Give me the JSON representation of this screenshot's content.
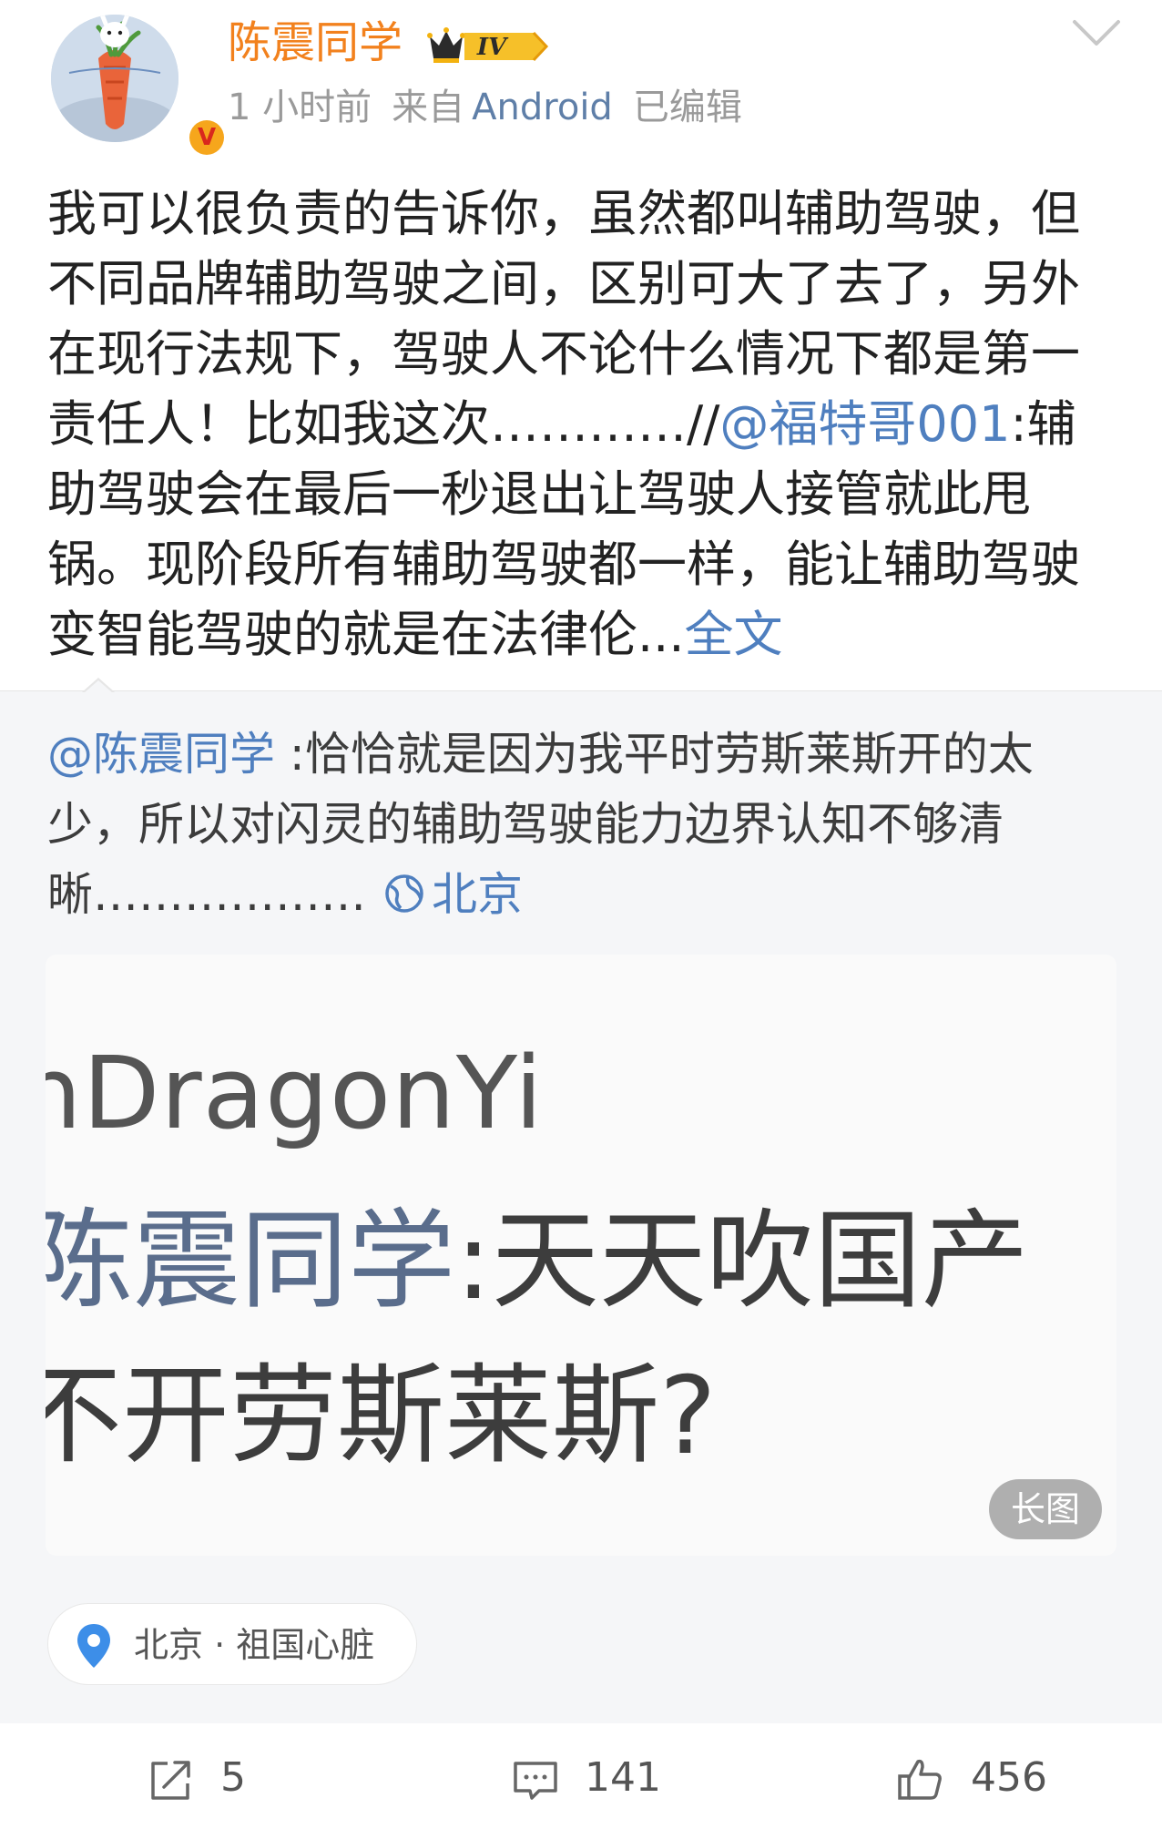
{
  "post": {
    "username": "陈震同学",
    "level_badge": "IV",
    "verified_badge": "V",
    "time": "1 小时前",
    "source_prefix": "来自",
    "source": "Android",
    "edited": "已编辑",
    "text_before_mention": "我可以很负责的告诉你，虽然都叫辅助驾驶，但不同品牌辅助驾驶之间，区别可大了去了，另外在现行法规下，驾驶人不论什么情况下都是第一责任人！比如我这次…………//",
    "mention": "@福特哥001",
    "text_after_mention": ":辅助驾驶会在最后一秒退出让驾驶人接管就此甩锅。现阶段所有辅助驾驶都一样，能让辅助驾驶变智能驾驶的就是在法律伦...",
    "full_text_link": "全文"
  },
  "repost": {
    "mention": "@陈震同学",
    "text": " :恰恰就是因为我平时劳斯莱斯开的太少，所以对闪灵的辅助驾驶能力边界认知不够清晰………………",
    "location": "北京",
    "image": {
      "line1": "nDragonYi",
      "line2_name": "陈震同学",
      "line2_rest": ":天天吹国产",
      "line3": "不开劳斯莱斯?",
      "long_image_tag": "长图"
    }
  },
  "location_pill": {
    "text": "北京 · 祖国心脏"
  },
  "actions": {
    "repost_count": "5",
    "comment_count": "141",
    "like_count": "456"
  },
  "colors": {
    "username": "#f2811d",
    "link": "#4f7fbf",
    "meta": "#9a9a9a",
    "repost_bg": "#f5f6f8",
    "pin": "#3d8ee8"
  },
  "icons": {
    "chevron": "chevron-down-icon",
    "globe": "globe-icon",
    "pin": "location-pin-icon",
    "repost": "share-icon",
    "comment": "comment-icon",
    "like": "thumbs-up-icon"
  }
}
